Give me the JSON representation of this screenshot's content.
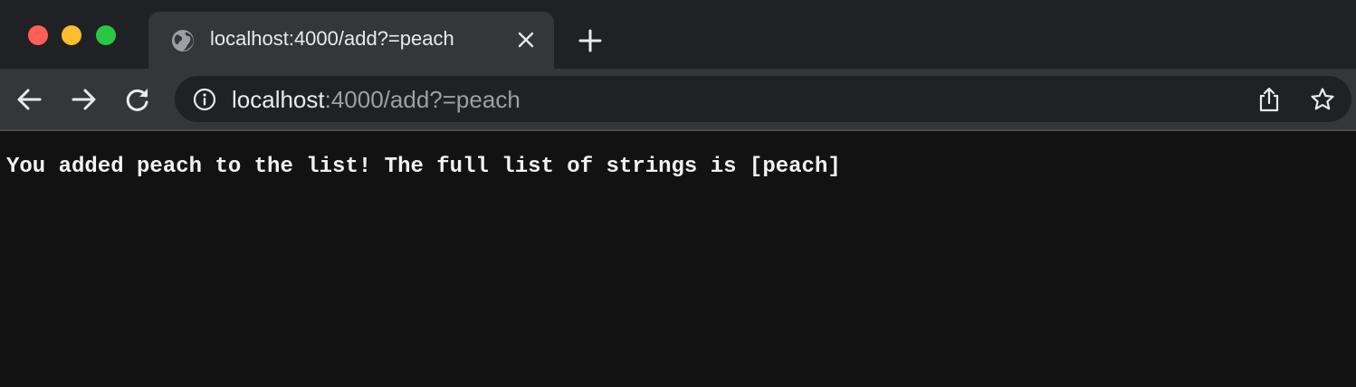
{
  "browser": {
    "tab": {
      "title": "localhost:4000/add?=peach",
      "favicon": "globe-icon"
    },
    "address_bar": {
      "host": "localhost",
      "rest": ":4000/add?=peach"
    },
    "icons": {
      "back": "arrow-left-icon",
      "forward": "arrow-right-icon",
      "reload": "reload-icon",
      "info": "info-icon",
      "share": "share-icon",
      "bookmark": "star-icon",
      "close_tab": "close-icon",
      "new_tab": "plus-icon"
    },
    "traffic_lights": {
      "close": "#ff5f57",
      "minimize": "#febc2e",
      "maximize": "#28c840"
    }
  },
  "page": {
    "message": "You added peach to the list! The full list of strings is [peach]"
  }
}
